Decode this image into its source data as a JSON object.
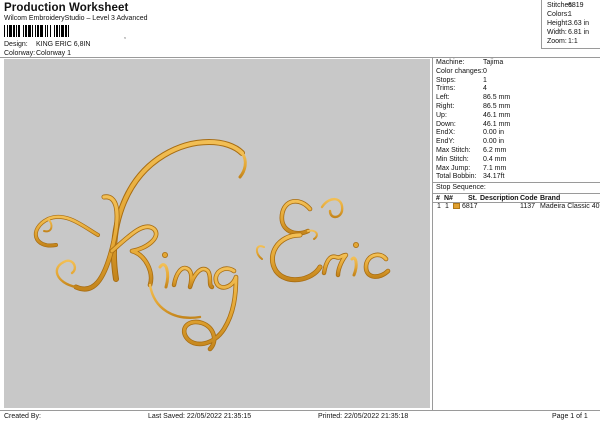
{
  "header": {
    "title": "Production Worksheet",
    "subtitle": "Wilcom EmbroideryStudio – Level 3 Advanced",
    "barcode_suffix": ","
  },
  "design_info": {
    "design_label": "Design:",
    "design_value": "KING ERIC 6,8IN",
    "colorway_label": "Colorway:",
    "colorway_value": "Colorway 1"
  },
  "stats": {
    "stitches_label": "Stitches:",
    "stitches_value": "6819",
    "colors_label": "Colors:",
    "colors_value": "1",
    "height_label": "Height:",
    "height_value": "3.63 in",
    "width_label": "Width:",
    "width_value": "6.81 in",
    "zoom_label": "Zoom:",
    "zoom_value": "1:1"
  },
  "design_preview": {
    "text": "King Eric",
    "thread_color": "#e3a634",
    "thread_shadow": "#a86d12",
    "background": "#c8c8c8"
  },
  "machine": [
    {
      "label": "Machine:",
      "value": "Tajima"
    },
    {
      "label": "Color changes:",
      "value": "0"
    },
    {
      "label": "Stops:",
      "value": "1"
    },
    {
      "label": "Trims:",
      "value": "4"
    },
    {
      "label": "Left:",
      "value": "86.5 mm"
    },
    {
      "label": "Right:",
      "value": "86.5 mm"
    },
    {
      "label": "Up:",
      "value": "46.1 mm"
    },
    {
      "label": "Down:",
      "value": "46.1 mm"
    },
    {
      "label": "EndX:",
      "value": "0.00 in"
    },
    {
      "label": "EndY:",
      "value": "0.00 in"
    },
    {
      "label": "Max Stitch:",
      "value": "6.2 mm"
    },
    {
      "label": "Min Stitch:",
      "value": "0.4 mm"
    },
    {
      "label": "Max Jump:",
      "value": "7.1 mm"
    },
    {
      "label": "Total Bobbin:",
      "value": "34.17ft"
    }
  ],
  "stop_sequence": {
    "title": "Stop Sequence:",
    "headers": {
      "num": "#",
      "n": "N#",
      "st": "St.",
      "description": "Description",
      "code": "Code",
      "brand": "Brand"
    },
    "rows": [
      {
        "num": "1",
        "n": "1",
        "color": "#e0a030",
        "st": "6817",
        "description": "",
        "code": "1137",
        "brand": "Madeira Classic 40"
      }
    ]
  },
  "footer": {
    "created_by": "Created By:",
    "last_saved": "Last Saved: 22/05/2022 21:35:15",
    "printed": "Printed: 22/05/2022 21:35:18",
    "page": "Page 1 of 1"
  }
}
